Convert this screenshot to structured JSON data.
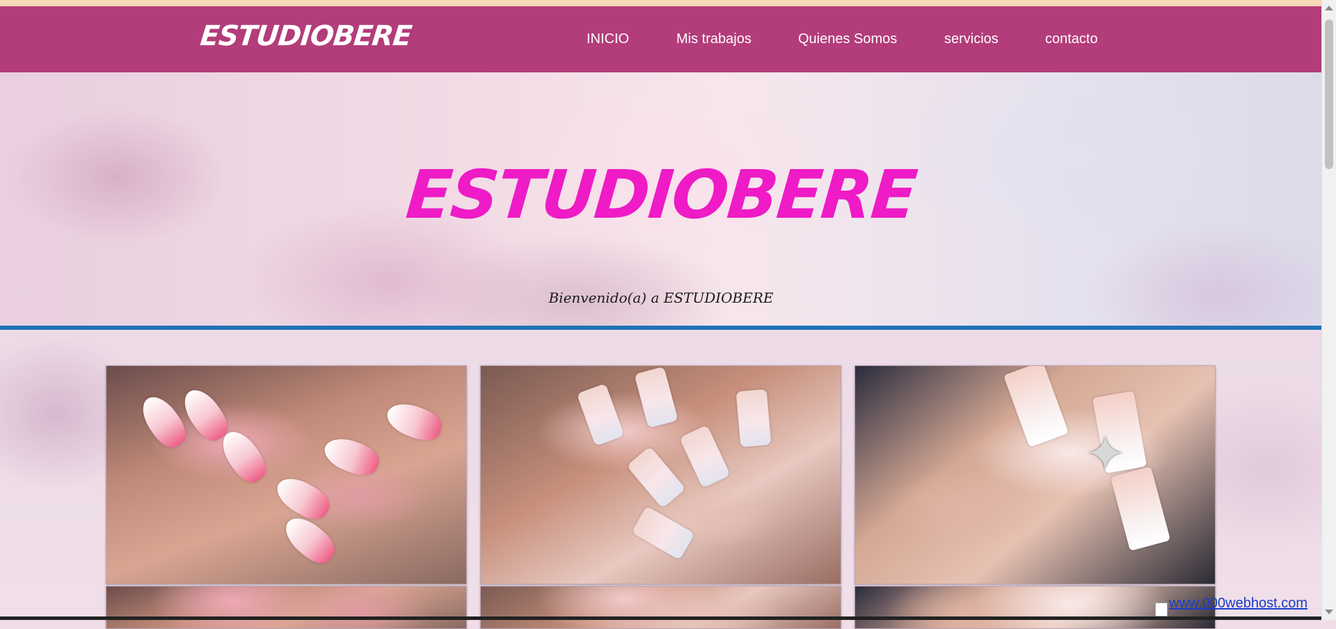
{
  "site": {
    "brand": "ESTUDIOBERE"
  },
  "nav": {
    "items": [
      {
        "label": "INICIO"
      },
      {
        "label": "Mis trabajos"
      },
      {
        "label": "Quienes Somos"
      },
      {
        "label": "servicios"
      },
      {
        "label": "contacto"
      }
    ]
  },
  "hero": {
    "title": "ESTUDIOBERE",
    "subtitle": "Bienvenido(a) a ESTUDIOBERE"
  },
  "gallery": {
    "photos": [
      {
        "name": "gallery-photo-pink-almond-nails"
      },
      {
        "name": "gallery-photo-glitter-snowflake-nails"
      },
      {
        "name": "gallery-photo-butterfly-charm-nails"
      }
    ]
  },
  "footer": {
    "host_link": "www.000webhost.com"
  },
  "colors": {
    "navbar": "#b33c7a",
    "hero_title": "#ee1bc6",
    "divider": "#1f73b8"
  }
}
